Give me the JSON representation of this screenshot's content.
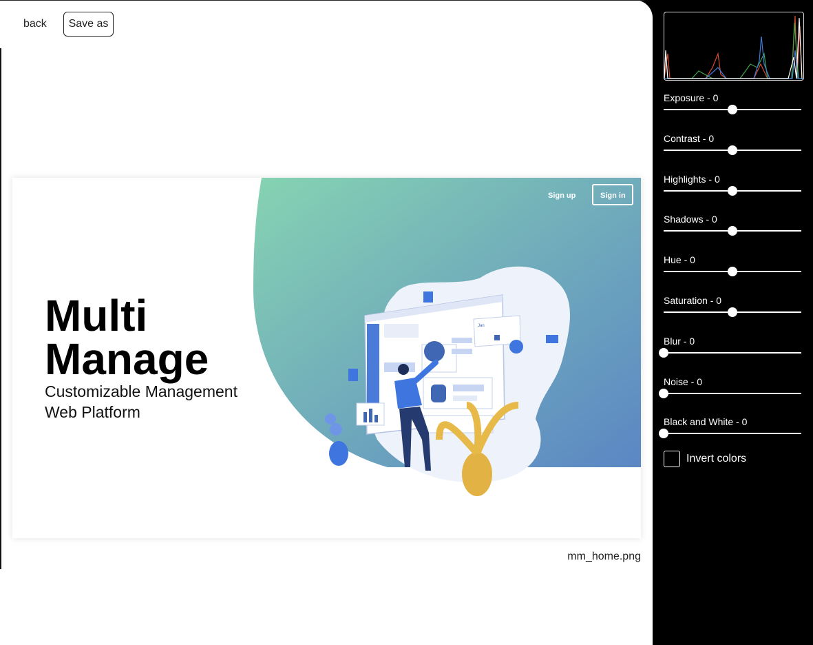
{
  "toolbar": {
    "back_label": "back",
    "save_as_label": "Save as"
  },
  "preview": {
    "filename": "mm_home.png",
    "image": {
      "title_line1": "Multi",
      "title_line2": "Manage",
      "subtitle_line1": "Customizable Management",
      "subtitle_line2": "Web Platform",
      "signup_label": "Sign up",
      "signin_label": "Sign in",
      "mini_card_label": "Jan"
    }
  },
  "panel": {
    "histogram_icon": "histogram",
    "adjustments": [
      {
        "name": "Exposure",
        "value": "0",
        "level": 0.5
      },
      {
        "name": "Contrast",
        "value": "0",
        "level": 0.5
      },
      {
        "name": "Highlights",
        "value": "0",
        "level": 0.5
      },
      {
        "name": "Shadows",
        "value": "0",
        "level": 0.5
      },
      {
        "name": "Hue",
        "value": "0",
        "level": 0.5
      },
      {
        "name": "Saturation",
        "value": "0",
        "level": 0.5
      },
      {
        "name": "Blur",
        "value": "0",
        "level": 0
      },
      {
        "name": "Noise",
        "value": "0",
        "level": 0
      },
      {
        "name": "Black and White",
        "value": "0",
        "level": 0
      }
    ],
    "invert": {
      "label": "Invert colors",
      "checked": false
    }
  }
}
